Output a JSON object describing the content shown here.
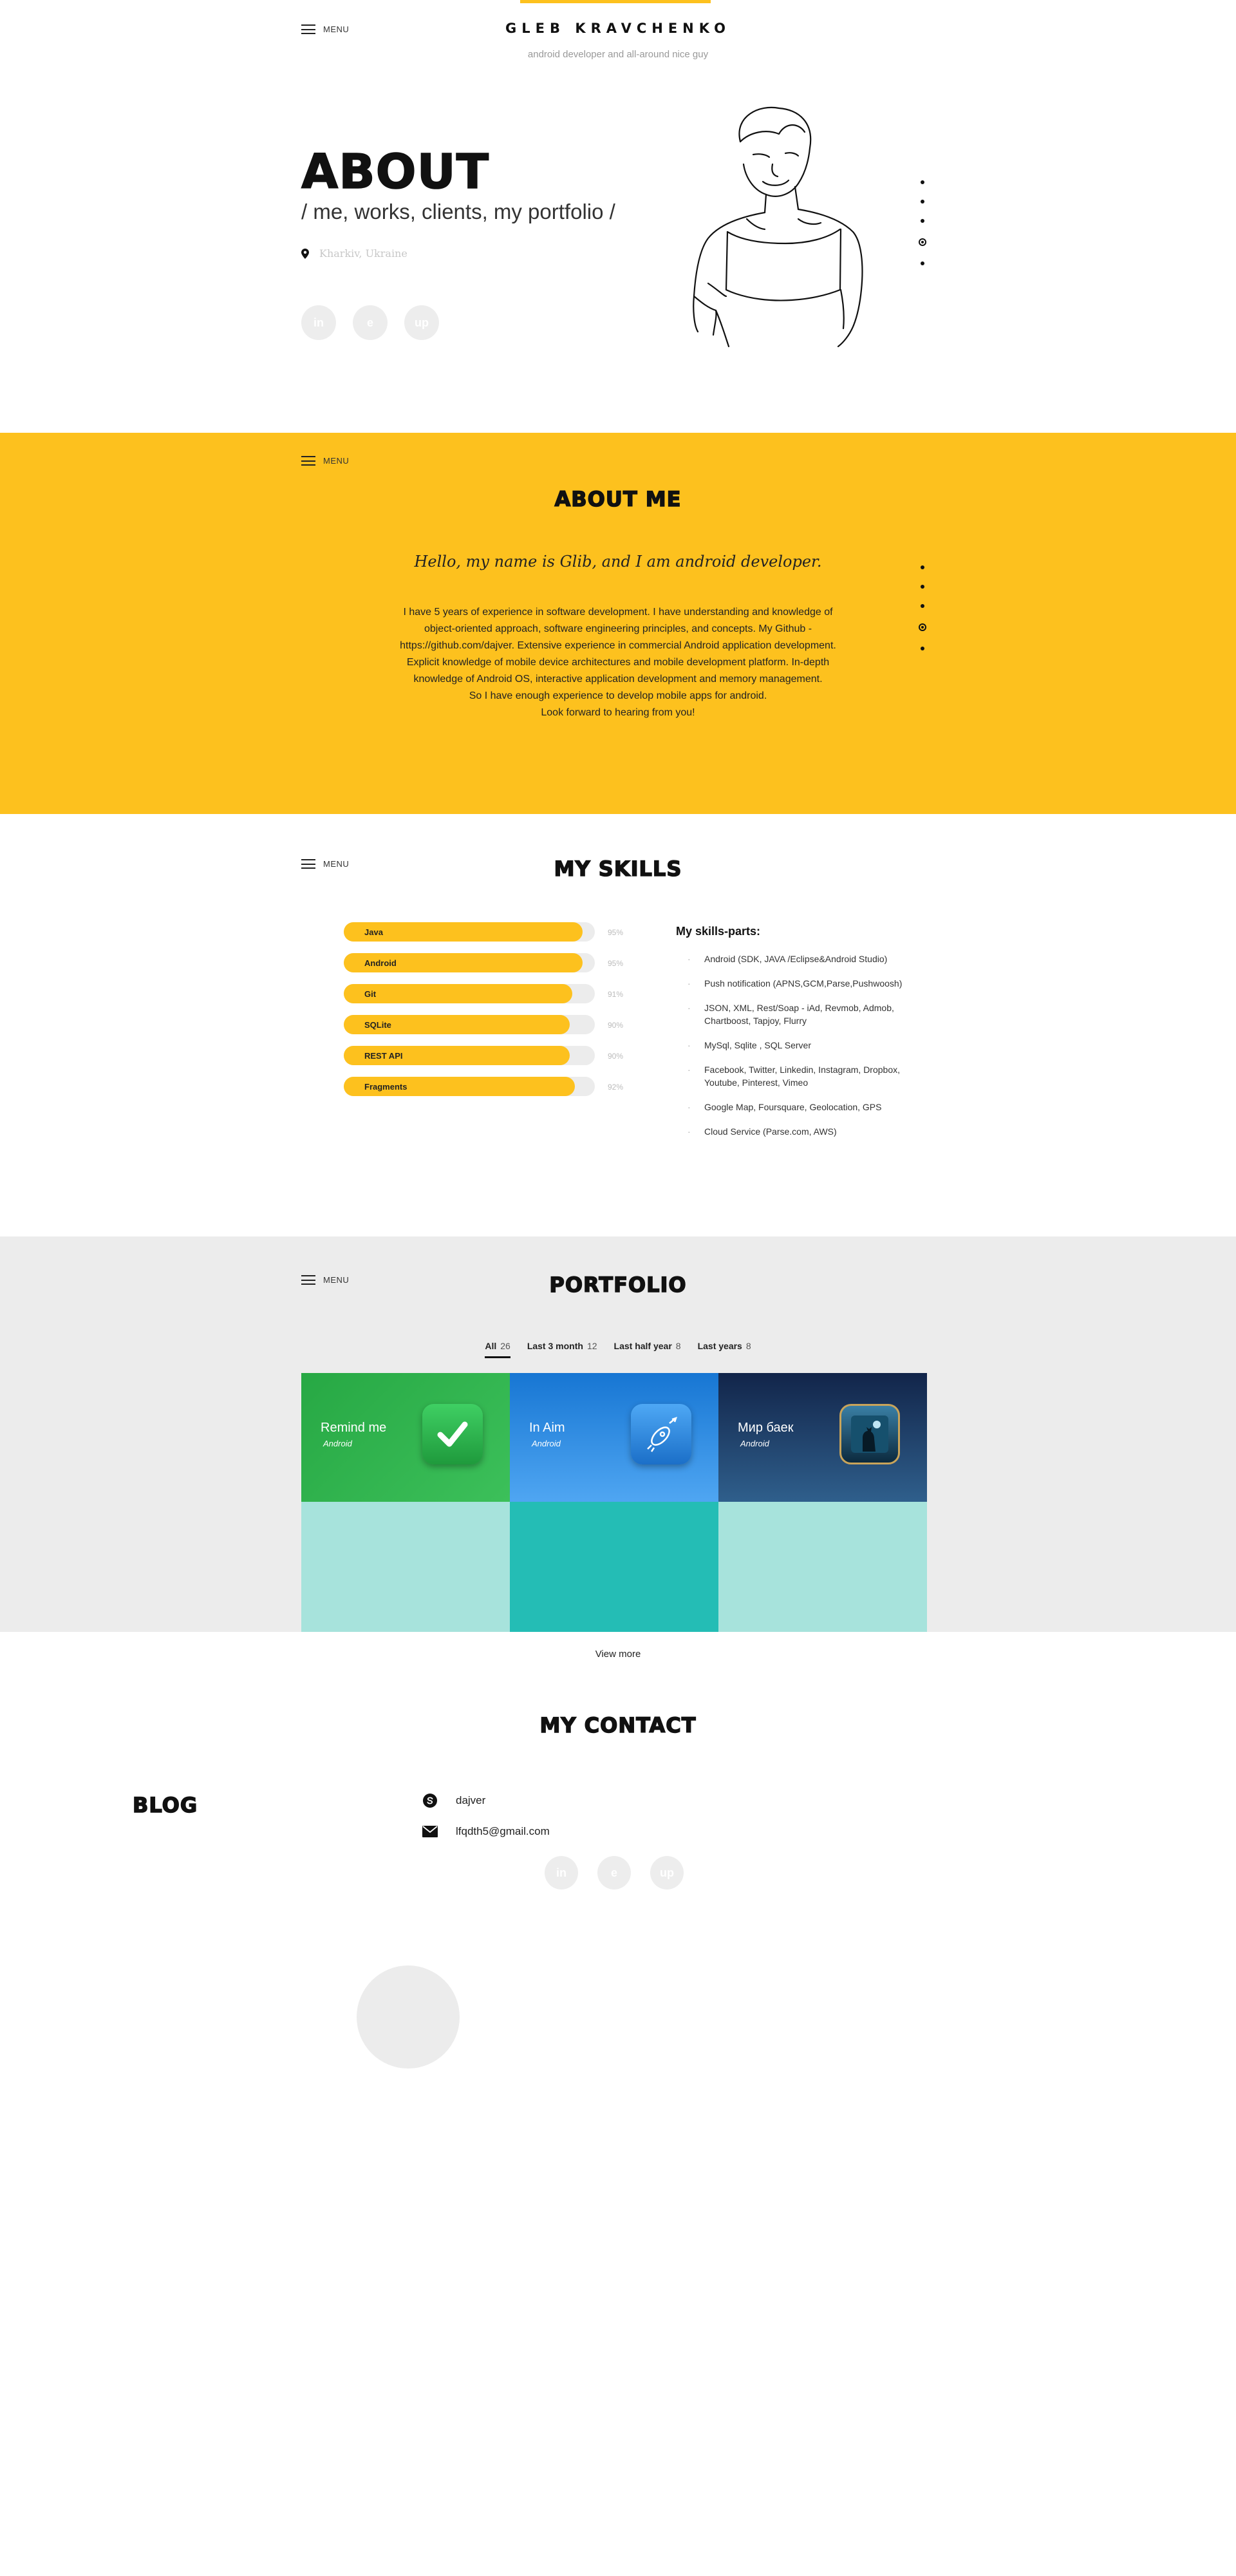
{
  "header": {
    "name": "GLEB KRAVCHENKO",
    "tagline": "android developer and all-around nice guy",
    "menu_label": "MENU"
  },
  "about": {
    "title": "ABOUT",
    "subtitle": "/ me, works, clients, my portfolio /",
    "location": "Kharkiv, Ukraine"
  },
  "social": [
    {
      "icon": "linkedin-icon",
      "label": "in"
    },
    {
      "icon": "freelancer-icon",
      "label": "e"
    },
    {
      "icon": "upwork-icon",
      "label": "up"
    }
  ],
  "about_me": {
    "menu_label": "MENU",
    "title": "ABOUT ME",
    "greeting": "Hello, my name is Glib, and I am android developer.",
    "lines": [
      "I have 5 years of experience in software development. I have understanding and knowledge of",
      "object-oriented approach, software engineering principles, and concepts.  My Github -",
      "https://github.com/dajver. Extensive experience in commercial Android application development.",
      "Explicit knowledge of mobile device architectures and mobile development platform. In-depth",
      "knowledge of Android OS, interactive application development and memory management.",
      "So I have enough experience to develop mobile apps for android.",
      "Look forward to hearing from you!"
    ]
  },
  "skills": {
    "menu_label": "MENU",
    "title": "MY SKILLS",
    "items": [
      {
        "name": "Java",
        "percent": 95,
        "label": "95%"
      },
      {
        "name": "Android",
        "percent": 95,
        "label": "95%"
      },
      {
        "name": "Git",
        "percent": 91,
        "label": "91%"
      },
      {
        "name": "SQLite",
        "percent": 90,
        "label": "90%"
      },
      {
        "name": "REST API",
        "percent": 90,
        "label": "90%"
      },
      {
        "name": "Fragments",
        "percent": 92,
        "label": "92%"
      }
    ],
    "parts_title": "My skills-parts:",
    "parts": [
      "Android (SDK, JAVA /Eclipse&Android Studio)",
      "Push notification (APNS,GCM,Parse,Pushwoosh)",
      "JSON, XML, Rest/Soap - iAd, Revmob, Admob,\nChartboost, Tapjoy, Flurry",
      "MySql, Sqlite , SQL Server",
      "Facebook, Twitter, Linkedin, Instagram, Dropbox,\nYoutube, Pinterest, Vimeo",
      "Google Map, Foursquare, Geolocation, GPS",
      "Cloud Service (Parse.com, AWS)"
    ]
  },
  "portfolio": {
    "menu_label": "MENU",
    "title": "PORTFOLIO",
    "tabs": [
      {
        "label": "All",
        "count": "26"
      },
      {
        "label": "Last 3 month",
        "count": "12"
      },
      {
        "label": "Last half year",
        "count": "8"
      },
      {
        "label": "Last years",
        "count": "8"
      }
    ],
    "items": [
      {
        "title": "Remind me",
        "platform": "Android",
        "icon": "checkmark-icon",
        "color": "#2fb34a"
      },
      {
        "title": "In Aim",
        "platform": "Android",
        "icon": "rocket-icon",
        "color": "#2f8fe0"
      },
      {
        "title": "Мир баек",
        "platform": "Android",
        "icon": "cat-night-icon",
        "color": "#17325c"
      }
    ],
    "placeholder_colors": [
      "#a7e3dc",
      "#24bdb5",
      "#a7e3dc"
    ],
    "view_more": "View more"
  },
  "contact": {
    "title": "MY CONTACT",
    "skype": "dajver",
    "email": "lfqdth5@gmail.com"
  },
  "blog": {
    "title": "BLOG"
  },
  "colors": {
    "accent": "#fdc11e",
    "grey_section": "#ececec"
  }
}
